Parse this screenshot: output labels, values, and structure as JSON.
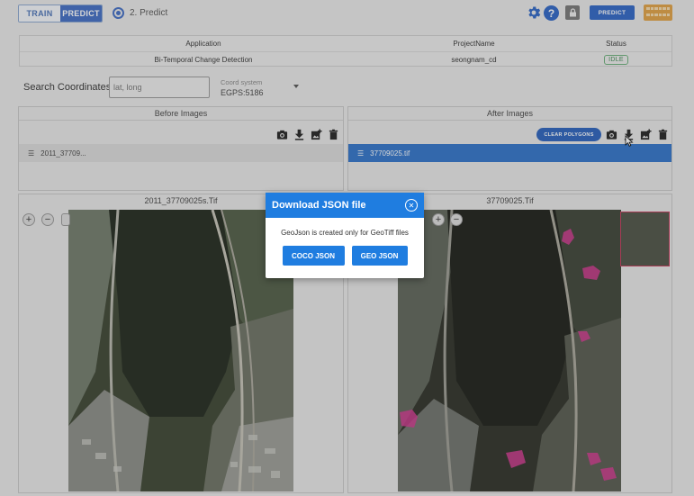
{
  "header": {
    "modes": [
      "TRAIN",
      "PREDICT"
    ],
    "step_label": "2. Predict",
    "help_label": "?",
    "predict_button": "PREDICT"
  },
  "info_table": {
    "headers": [
      "Application",
      "ProjectName",
      "Status"
    ],
    "row": {
      "application": "Bi-Temporal Change Detection",
      "project": "seongnam_cd",
      "status": "IDLE"
    }
  },
  "search": {
    "label": "Search Coordinates:",
    "placeholder": "lat, long",
    "coord_system_label": "Coord system",
    "coord_system_value": "EGPS:5186"
  },
  "before_panel": {
    "title": "Before Images",
    "file": "2011_37709..."
  },
  "after_panel": {
    "title": "After Images",
    "file": "37709025.tif",
    "clear_button": "CLEAR POLYGONS"
  },
  "before_view": {
    "title": "2011_37709025s.Tif"
  },
  "after_view": {
    "title": "37709025.Tif"
  },
  "zoom": {
    "in": "+",
    "out": "−"
  },
  "modal": {
    "title": "Download JSON file",
    "message": "GeoJson is created only for GeoTiff files",
    "buttons": [
      "COCO JSON",
      "GEO JSON"
    ]
  },
  "colors": {
    "accent": "#2c64c6",
    "modal_accent": "#1f7de0",
    "selected_row": "#2f73c9",
    "change_polygon": "#d2368f",
    "status_idle": "#3e8a52"
  }
}
